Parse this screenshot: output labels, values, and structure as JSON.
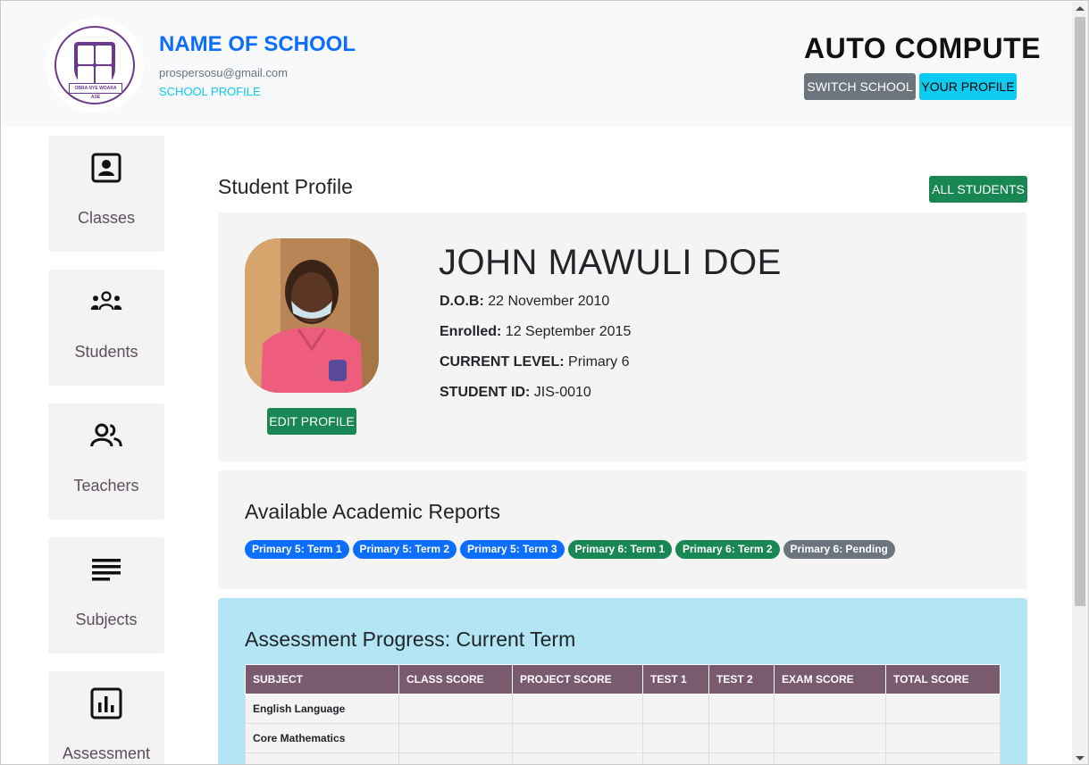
{
  "header": {
    "school_name": "NAME OF SCHOOL",
    "email": "prospersosu@gmail.com",
    "school_profile_link": "SCHOOL PROFILE",
    "app_title": "AUTO COMPUTE",
    "switch_school_label": "SWITCH SCHOOL",
    "your_profile_label": "YOUR PROFILE",
    "logo_motto": "OBRA NYE WOARA ASE"
  },
  "sidebar": {
    "items": [
      {
        "label": "Classes",
        "icon": "person-badge-icon"
      },
      {
        "label": "Students",
        "icon": "people-group-icon"
      },
      {
        "label": "Teachers",
        "icon": "people-icon"
      },
      {
        "label": "Subjects",
        "icon": "list-lines-icon"
      },
      {
        "label": "Assessment",
        "icon": "bar-chart-icon"
      }
    ]
  },
  "main": {
    "page_title": "Student Profile",
    "all_students_label": "ALL STUDENTS",
    "edit_profile_label": "EDIT PROFILE",
    "student": {
      "name": "JOHN MAWULI DOE",
      "dob_label": "D.O.B:",
      "dob": "22 November 2010",
      "enrolled_label": "Enrolled:",
      "enrolled": "12 September 2015",
      "level_label": "CURRENT LEVEL:",
      "level": "Primary 6",
      "id_label": "STUDENT ID:",
      "id": "JIS-0010"
    },
    "reports": {
      "title": "Available Academic Reports",
      "badges": [
        {
          "label": "Primary 5: Term 1",
          "color": "#0d6efd"
        },
        {
          "label": "Primary 5: Term 2",
          "color": "#0d6efd"
        },
        {
          "label": "Primary 5: Term 3",
          "color": "#0d6efd"
        },
        {
          "label": "Primary 6: Term 1",
          "color": "#198754"
        },
        {
          "label": "Primary 6: Term 2",
          "color": "#198754"
        },
        {
          "label": "Primary 6: Pending",
          "color": "#6c757d"
        }
      ]
    },
    "assessment": {
      "title": "Assessment Progress: Current Term",
      "columns": [
        "SUBJECT",
        "CLASS SCORE",
        "PROJECT SCORE",
        "TEST 1",
        "TEST 2",
        "EXAM SCORE",
        "TOTAL SCORE"
      ],
      "rows": [
        [
          "English Language",
          "",
          "",
          "",
          "",
          "",
          ""
        ],
        [
          "Core Mathematics",
          "",
          "",
          "",
          "",
          "",
          ""
        ],
        [
          "",
          "",
          "",
          "",
          "",
          "",
          ""
        ]
      ]
    }
  },
  "colors": {
    "primary": "#0d6efd",
    "success": "#198754",
    "info": "#0dcaf0",
    "secondary": "#6c757d",
    "table_header": "#795a6f",
    "assessment_bg": "#b3e5f5"
  }
}
